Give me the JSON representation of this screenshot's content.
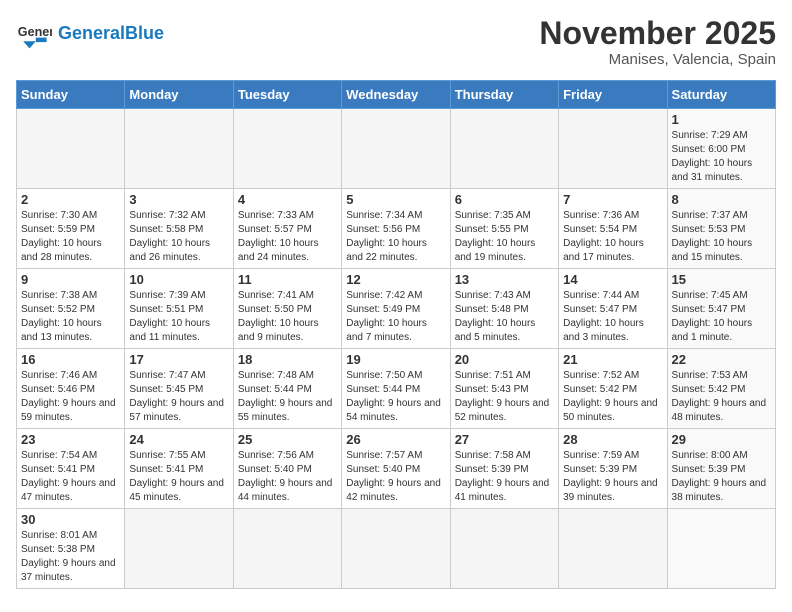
{
  "header": {
    "logo_general": "General",
    "logo_blue": "Blue",
    "month_title": "November 2025",
    "location": "Manises, Valencia, Spain"
  },
  "days_of_week": [
    "Sunday",
    "Monday",
    "Tuesday",
    "Wednesday",
    "Thursday",
    "Friday",
    "Saturday"
  ],
  "weeks": [
    [
      {
        "day": "",
        "info": ""
      },
      {
        "day": "",
        "info": ""
      },
      {
        "day": "",
        "info": ""
      },
      {
        "day": "",
        "info": ""
      },
      {
        "day": "",
        "info": ""
      },
      {
        "day": "",
        "info": ""
      },
      {
        "day": "1",
        "info": "Sunrise: 7:29 AM\nSunset: 6:00 PM\nDaylight: 10 hours and 31 minutes."
      }
    ],
    [
      {
        "day": "2",
        "info": "Sunrise: 7:30 AM\nSunset: 5:59 PM\nDaylight: 10 hours and 28 minutes."
      },
      {
        "day": "3",
        "info": "Sunrise: 7:32 AM\nSunset: 5:58 PM\nDaylight: 10 hours and 26 minutes."
      },
      {
        "day": "4",
        "info": "Sunrise: 7:33 AM\nSunset: 5:57 PM\nDaylight: 10 hours and 24 minutes."
      },
      {
        "day": "5",
        "info": "Sunrise: 7:34 AM\nSunset: 5:56 PM\nDaylight: 10 hours and 22 minutes."
      },
      {
        "day": "6",
        "info": "Sunrise: 7:35 AM\nSunset: 5:55 PM\nDaylight: 10 hours and 19 minutes."
      },
      {
        "day": "7",
        "info": "Sunrise: 7:36 AM\nSunset: 5:54 PM\nDaylight: 10 hours and 17 minutes."
      },
      {
        "day": "8",
        "info": "Sunrise: 7:37 AM\nSunset: 5:53 PM\nDaylight: 10 hours and 15 minutes."
      }
    ],
    [
      {
        "day": "9",
        "info": "Sunrise: 7:38 AM\nSunset: 5:52 PM\nDaylight: 10 hours and 13 minutes."
      },
      {
        "day": "10",
        "info": "Sunrise: 7:39 AM\nSunset: 5:51 PM\nDaylight: 10 hours and 11 minutes."
      },
      {
        "day": "11",
        "info": "Sunrise: 7:41 AM\nSunset: 5:50 PM\nDaylight: 10 hours and 9 minutes."
      },
      {
        "day": "12",
        "info": "Sunrise: 7:42 AM\nSunset: 5:49 PM\nDaylight: 10 hours and 7 minutes."
      },
      {
        "day": "13",
        "info": "Sunrise: 7:43 AM\nSunset: 5:48 PM\nDaylight: 10 hours and 5 minutes."
      },
      {
        "day": "14",
        "info": "Sunrise: 7:44 AM\nSunset: 5:47 PM\nDaylight: 10 hours and 3 minutes."
      },
      {
        "day": "15",
        "info": "Sunrise: 7:45 AM\nSunset: 5:47 PM\nDaylight: 10 hours and 1 minute."
      }
    ],
    [
      {
        "day": "16",
        "info": "Sunrise: 7:46 AM\nSunset: 5:46 PM\nDaylight: 9 hours and 59 minutes."
      },
      {
        "day": "17",
        "info": "Sunrise: 7:47 AM\nSunset: 5:45 PM\nDaylight: 9 hours and 57 minutes."
      },
      {
        "day": "18",
        "info": "Sunrise: 7:48 AM\nSunset: 5:44 PM\nDaylight: 9 hours and 55 minutes."
      },
      {
        "day": "19",
        "info": "Sunrise: 7:50 AM\nSunset: 5:44 PM\nDaylight: 9 hours and 54 minutes."
      },
      {
        "day": "20",
        "info": "Sunrise: 7:51 AM\nSunset: 5:43 PM\nDaylight: 9 hours and 52 minutes."
      },
      {
        "day": "21",
        "info": "Sunrise: 7:52 AM\nSunset: 5:42 PM\nDaylight: 9 hours and 50 minutes."
      },
      {
        "day": "22",
        "info": "Sunrise: 7:53 AM\nSunset: 5:42 PM\nDaylight: 9 hours and 48 minutes."
      }
    ],
    [
      {
        "day": "23",
        "info": "Sunrise: 7:54 AM\nSunset: 5:41 PM\nDaylight: 9 hours and 47 minutes."
      },
      {
        "day": "24",
        "info": "Sunrise: 7:55 AM\nSunset: 5:41 PM\nDaylight: 9 hours and 45 minutes."
      },
      {
        "day": "25",
        "info": "Sunrise: 7:56 AM\nSunset: 5:40 PM\nDaylight: 9 hours and 44 minutes."
      },
      {
        "day": "26",
        "info": "Sunrise: 7:57 AM\nSunset: 5:40 PM\nDaylight: 9 hours and 42 minutes."
      },
      {
        "day": "27",
        "info": "Sunrise: 7:58 AM\nSunset: 5:39 PM\nDaylight: 9 hours and 41 minutes."
      },
      {
        "day": "28",
        "info": "Sunrise: 7:59 AM\nSunset: 5:39 PM\nDaylight: 9 hours and 39 minutes."
      },
      {
        "day": "29",
        "info": "Sunrise: 8:00 AM\nSunset: 5:39 PM\nDaylight: 9 hours and 38 minutes."
      }
    ],
    [
      {
        "day": "30",
        "info": "Sunrise: 8:01 AM\nSunset: 5:38 PM\nDaylight: 9 hours and 37 minutes."
      },
      {
        "day": "",
        "info": ""
      },
      {
        "day": "",
        "info": ""
      },
      {
        "day": "",
        "info": ""
      },
      {
        "day": "",
        "info": ""
      },
      {
        "day": "",
        "info": ""
      },
      {
        "day": "",
        "info": ""
      }
    ]
  ]
}
